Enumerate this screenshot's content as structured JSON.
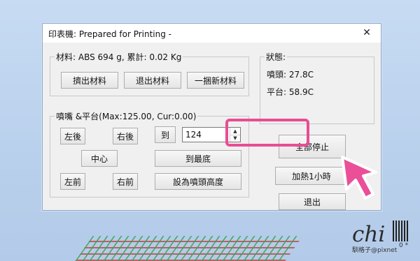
{
  "window": {
    "title": "印表機: Prepared for Printing -",
    "close_glyph": "✕"
  },
  "material": {
    "label": "材料: ABS 694 g,  累計: 0.02 Kg",
    "buttons": [
      "擠出材料",
      "退出材料",
      "一捆新材料"
    ]
  },
  "status": {
    "label": "狀態:",
    "nozzle": "噴頭: 27.8C",
    "platform": "平台: 58.9C"
  },
  "nozzle_platform": {
    "label": "噴嘴 &平台(Max:125.00, Cur:0.00)",
    "left_back": "左後",
    "right_back": "右後",
    "center": "中心",
    "left_front": "左前",
    "right_front": "右前",
    "goto": "到",
    "goto_value": "124",
    "to_bottom": "到最底",
    "set_height": "設為噴頭高度"
  },
  "actions": {
    "stop_all": "全部停止",
    "heat_1h": "加熱1小時",
    "exit": "退出"
  },
  "watermark": {
    "brand": "chi",
    "caption": "馴格子@pixnet",
    "code": "0 *"
  },
  "colors": {
    "highlight": "#e84d93",
    "cursor": "#ea4f98"
  }
}
